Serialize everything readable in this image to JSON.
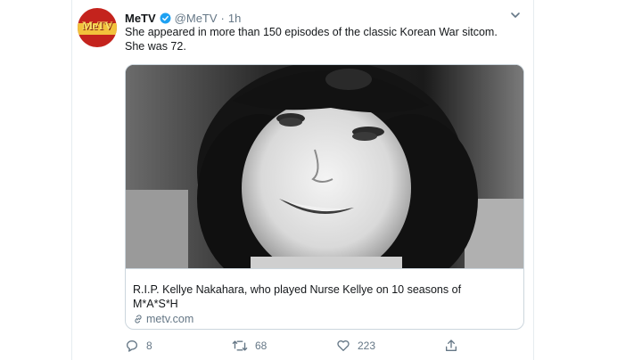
{
  "tweet": {
    "author_name": "MeTV",
    "handle": "@MeTV",
    "separator": "·",
    "time": "1h",
    "text_line1": "She appeared in more than 150 episodes of the classic Korean War sitcom.",
    "text_line2": "She was 72.",
    "avatar_logo": "MeTV"
  },
  "card": {
    "title_line1": "R.I.P. Kellye Nakahara, who played Nurse Kellye on 10 seasons of",
    "title_line2": "M*A*S*H",
    "domain": "metv.com"
  },
  "actions": {
    "replies": "8",
    "retweets": "68",
    "likes": "223"
  },
  "icons": [
    "verified-icon",
    "chevron-down-icon",
    "link-icon",
    "reply-icon",
    "retweet-icon",
    "like-icon",
    "share-icon"
  ],
  "colors": {
    "verified": "#1da1f2",
    "muted": "#657786",
    "text": "#14171a",
    "border": "#ccd6dd"
  }
}
